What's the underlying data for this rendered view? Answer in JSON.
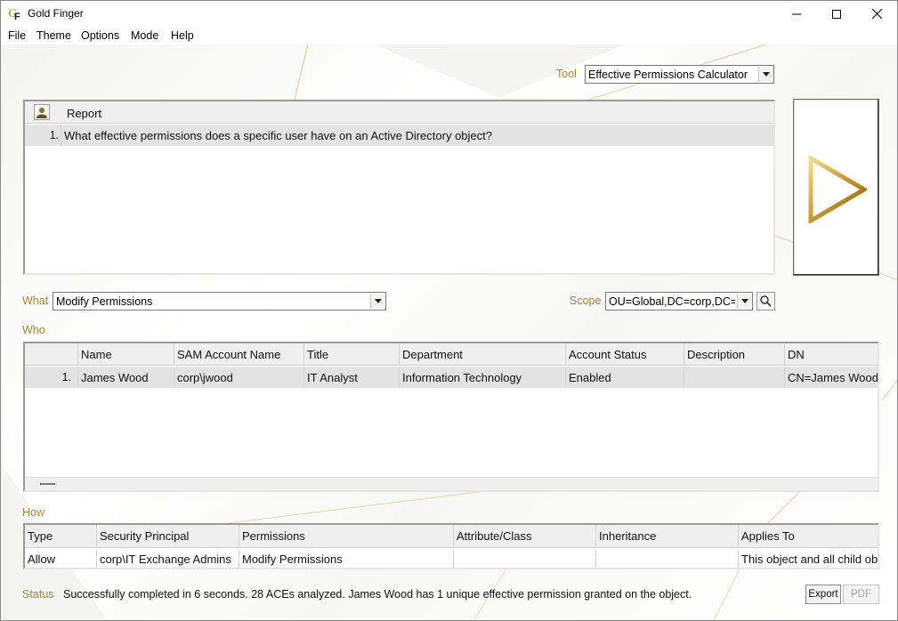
{
  "window": {
    "title": "Gold Finger",
    "controls": {
      "minimize": "minimize-icon",
      "maximize": "maximize-icon",
      "close": "close-icon"
    }
  },
  "menu": [
    "File",
    "Theme",
    "Options",
    "Mode",
    "Help"
  ],
  "tool": {
    "label": "Tool",
    "selected": "Effective Permissions Calculator"
  },
  "report": {
    "header": "Report",
    "rows": [
      {
        "num": "1.",
        "text": "What effective permissions does a specific user have on an Active Directory object?"
      }
    ]
  },
  "what": {
    "label": "What",
    "selected": "Modify Permissions"
  },
  "scope": {
    "label": "Scope",
    "selected": "OU=Global,DC=corp,DC="
  },
  "who": {
    "label": "Who",
    "columns": [
      "Name",
      "SAM Account Name",
      "Title",
      "Department",
      "Account Status",
      "Description",
      "DN"
    ],
    "rows": [
      {
        "num": "1.",
        "cells": [
          "James Wood",
          "corp\\jwood",
          "IT Analyst",
          "Information Technology",
          "Enabled",
          "",
          "CN=James Wood"
        ]
      }
    ]
  },
  "how": {
    "label": "How",
    "columns": [
      "Type",
      "Security Principal",
      "Permissions",
      "Attribute/Class",
      "Inheritance",
      "Applies To"
    ],
    "rows": [
      {
        "cells": [
          "Allow",
          "corp\\IT Exchange Admins",
          "Modify Permissions",
          "",
          "",
          "This object and all child ob"
        ]
      }
    ]
  },
  "status": {
    "label": "Status",
    "text": "Successfully completed in 6 seconds.  28 ACEs analyzed. James Wood has 1 unique effective permission granted on the object."
  },
  "buttons": {
    "export": "Export",
    "pdf": "PDF"
  },
  "colors": {
    "accent_gold": "#a8843a",
    "selection": "#e3e3e3"
  }
}
